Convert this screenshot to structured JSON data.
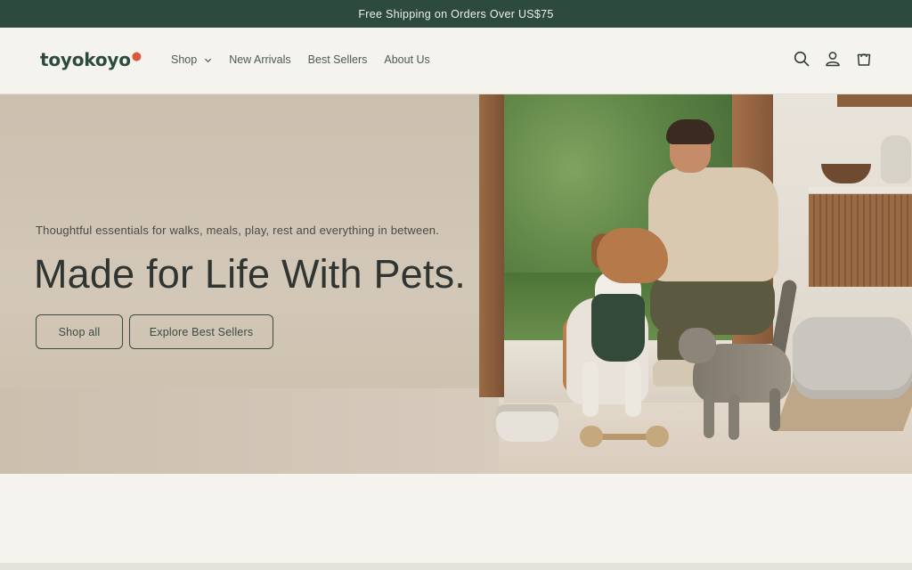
{
  "announcement": {
    "text": "Free Shipping on Orders Over US$75"
  },
  "header": {
    "logo": "toyokoyo",
    "nav": [
      {
        "label": "Shop",
        "has_dropdown": true
      },
      {
        "label": "New Arrivals"
      },
      {
        "label": "Best Sellers"
      },
      {
        "label": "About Us"
      }
    ],
    "icons": [
      "search-icon",
      "account-icon",
      "cart-icon"
    ]
  },
  "hero": {
    "subtitle": "Thoughtful essentials for walks, meals, play, rest and everything in between.",
    "headline": "Made for Life With Pets.",
    "buttons": [
      {
        "label": "Shop all"
      },
      {
        "label": "Explore Best Sellers"
      }
    ]
  },
  "colors": {
    "announcement_bg": "#2d4a3e",
    "page_bg": "#f5f3ee",
    "button_border": "#3a4b42",
    "logo_accent": "#d9583f"
  }
}
